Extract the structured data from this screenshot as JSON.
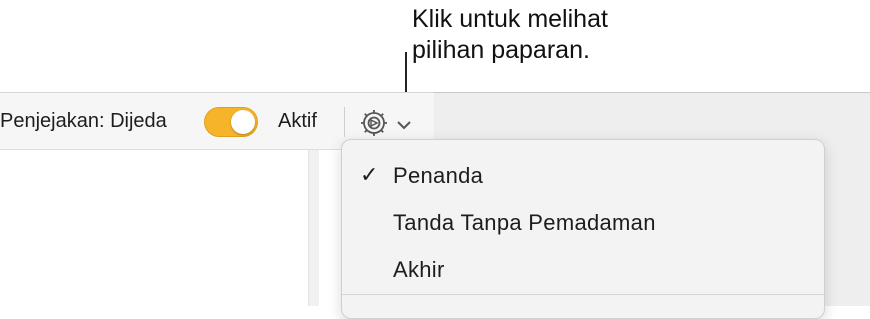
{
  "callout": {
    "line1": "Klik untuk melihat",
    "line2": "pilihan paparan."
  },
  "toolbar": {
    "tracking_label": "Penjejakan: Dijeda",
    "tracking_toggle_on": true,
    "tracking_state": "Aktif",
    "view_button_icon": "gear-icon",
    "view_button_chevron": "chevron-down-icon",
    "accent_color": "#f6b42b"
  },
  "view_menu": {
    "items": [
      {
        "label": "Penanda",
        "checked": true,
        "check_glyph": "✓"
      },
      {
        "label": "Tanda Tanpa Pemadaman",
        "checked": false
      },
      {
        "label": "Akhir",
        "checked": false
      }
    ]
  }
}
